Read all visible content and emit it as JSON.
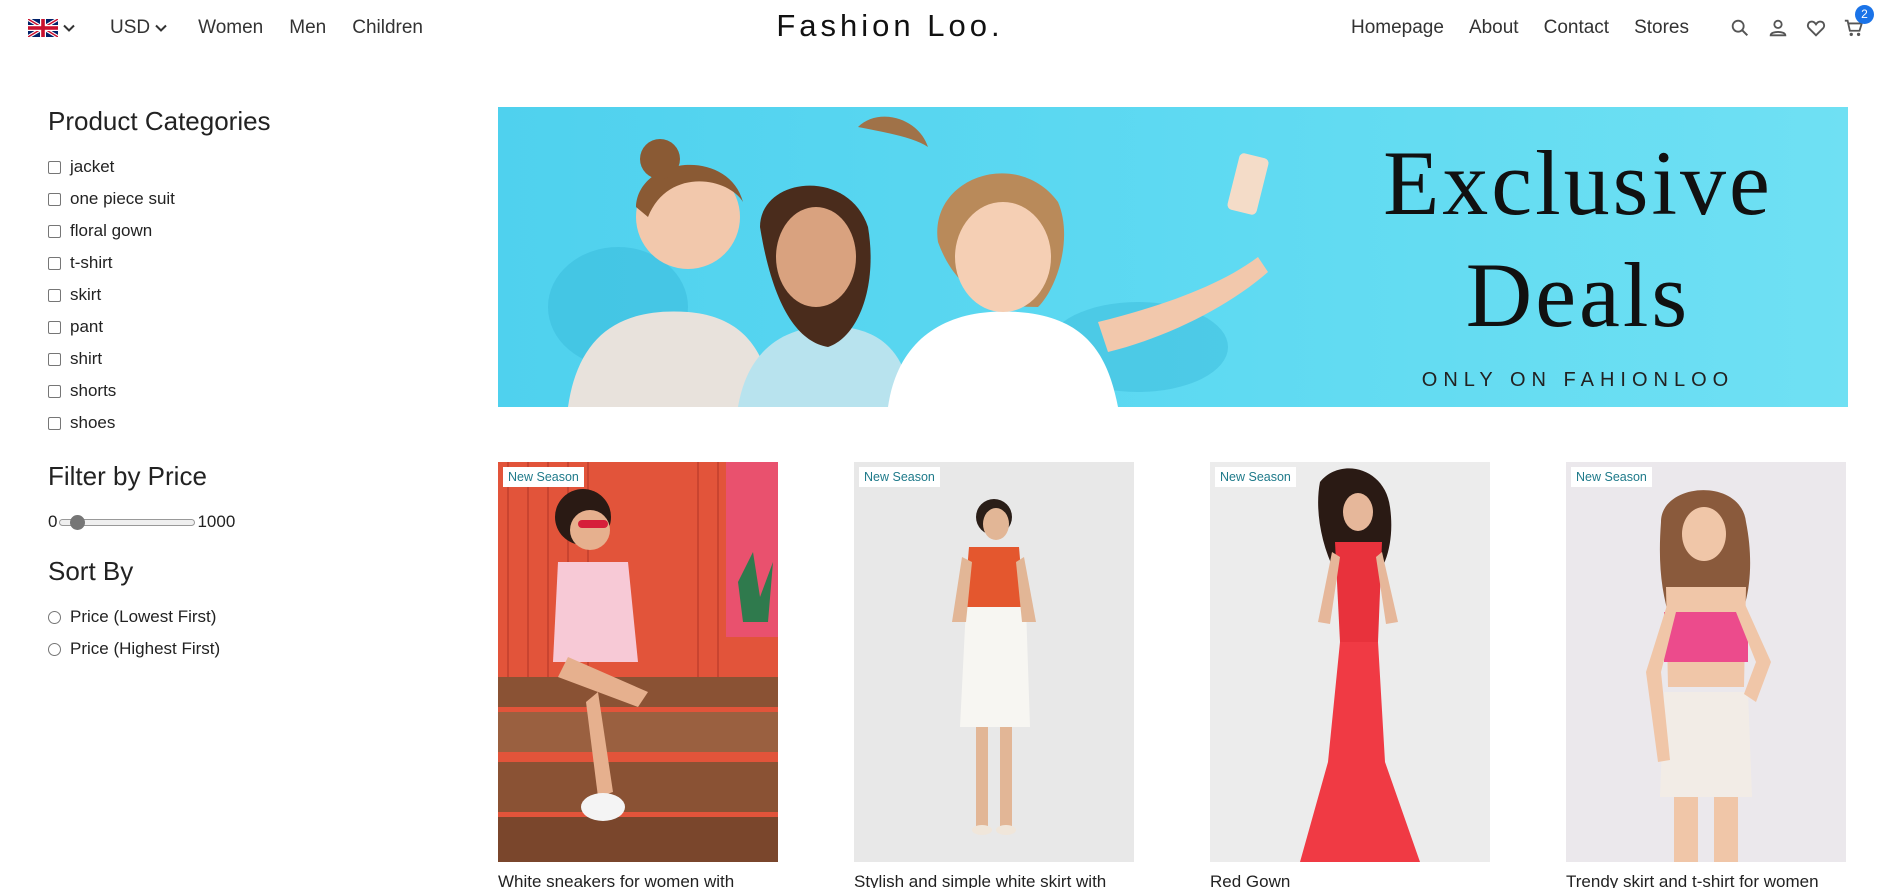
{
  "nav": {
    "flag": "uk-flag-icon",
    "currency": "USD",
    "left_links": [
      "Women",
      "Men",
      "Children"
    ],
    "brand": "Fashion Loo.",
    "right_links": [
      "Homepage",
      "About",
      "Contact",
      "Stores"
    ],
    "icons": [
      "search-icon",
      "user-icon",
      "heart-icon",
      "cart-icon"
    ],
    "cart_count": "2"
  },
  "sidebar": {
    "categories_title": "Product Categories",
    "categories": [
      "jacket",
      "one piece suit",
      "floral gown",
      "t-shirt",
      "skirt",
      "pant",
      "shirt",
      "shorts",
      "shoes"
    ],
    "price_title": "Filter by Price",
    "price_min": "0",
    "price_max": "1000",
    "sort_title": "Sort By",
    "sort_options": [
      "Price (Lowest First)",
      "Price (Highest First)"
    ]
  },
  "banner": {
    "line1": "Exclusive",
    "line2": "Deals",
    "subtitle": "ONLY ON FAHIONLOO"
  },
  "products": [
    {
      "badge": "New Season",
      "title": "White sneakers for women with"
    },
    {
      "badge": "New Season",
      "title": "Stylish and simple white skirt with"
    },
    {
      "badge": "New Season",
      "title": "Red Gown"
    },
    {
      "badge": "New Season",
      "title": "Trendy skirt and t-shirt for women"
    }
  ],
  "colors": {
    "banner_bg": "#5fdaf2",
    "badge_text": "#1e7a8a",
    "cart_badge": "#1a73e8"
  }
}
